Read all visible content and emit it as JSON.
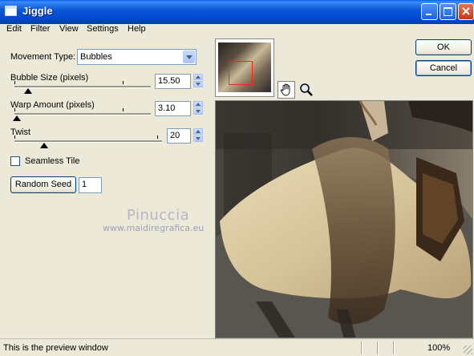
{
  "window": {
    "title": "Jiggle"
  },
  "menu": [
    "Edit",
    "Filter",
    "View",
    "Settings",
    "Help"
  ],
  "controls": {
    "movement_type_label": "Movement Type:",
    "movement_type_value": "Bubbles",
    "bubble_size_label": "Bubble Size (pixels)",
    "bubble_size_value": "15.50",
    "warp_amount_label": "Warp Amount (pixels)",
    "warp_amount_value": "3.10",
    "twist_label": "Twist",
    "twist_value": "20",
    "seamless_tile_label": "Seamless Tile",
    "random_seed_label": "Random Seed",
    "random_seed_value": "1"
  },
  "buttons": {
    "ok": "OK",
    "cancel": "Cancel"
  },
  "watermark": {
    "name": "Pinuccia",
    "url": "www.maidiregrafica.eu"
  },
  "status": {
    "text": "This is the preview window",
    "zoom": "100%"
  },
  "icons": {
    "hand_tool": "hand-icon",
    "zoom_tool": "magnifier-icon"
  }
}
